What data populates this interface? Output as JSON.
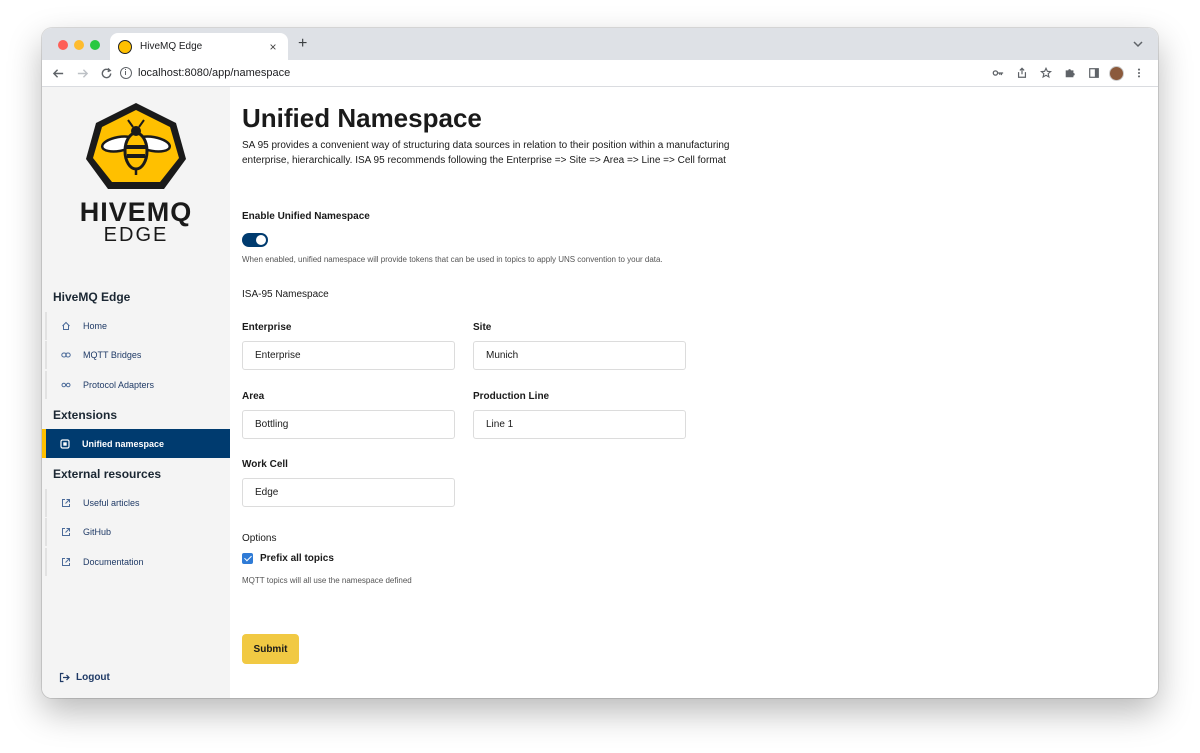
{
  "browser": {
    "tab_title": "HiveMQ Edge",
    "new_tab": "+",
    "tab_close": "×",
    "url": "localhost:8080/app/namespace"
  },
  "sidebar": {
    "logo_word": "HIVEMQ",
    "logo_sub": "EDGE",
    "sections": [
      {
        "title": "HiveMQ Edge",
        "items": [
          {
            "label": "Home",
            "icon": "home-icon"
          },
          {
            "label": "MQTT Bridges",
            "icon": "link-icon"
          },
          {
            "label": "Protocol Adapters",
            "icon": "adapter-icon"
          }
        ]
      },
      {
        "title": "Extensions",
        "items": [
          {
            "label": "Unified namespace",
            "icon": "namespace-icon",
            "active": true
          }
        ]
      },
      {
        "title": "External resources",
        "items": [
          {
            "label": "Useful articles",
            "icon": "external-link-icon"
          },
          {
            "label": "GitHub",
            "icon": "external-link-icon"
          },
          {
            "label": "Documentation",
            "icon": "external-link-icon"
          }
        ]
      }
    ],
    "logout": "Logout"
  },
  "main": {
    "title": "Unified Namespace",
    "description": "SA 95 provides a convenient way of structuring data sources in relation to their position within a manufacturing enterprise, hierarchically. ISA 95 recommends following the Enterprise => Site => Area => Line => Cell format",
    "enable_label": "Enable Unified Namespace",
    "enable_value": true,
    "enable_helper": "When enabled, unified namespace will provide tokens that can be used in topics to apply UNS convention to your data.",
    "namespace_heading": "ISA-95 Namespace",
    "fields": {
      "enterprise": {
        "label": "Enterprise",
        "value": "Enterprise"
      },
      "site": {
        "label": "Site",
        "value": "Munich"
      },
      "area": {
        "label": "Area",
        "value": "Bottling"
      },
      "production_line": {
        "label": "Production Line",
        "value": "Line 1"
      },
      "work_cell": {
        "label": "Work Cell",
        "value": "Edge"
      }
    },
    "options_heading": "Options",
    "prefix_label": "Prefix all topics",
    "prefix_checked": true,
    "prefix_helper": "MQTT topics will all use the namespace defined",
    "submit_label": "Submit"
  },
  "colors": {
    "brand_yellow": "#ffc000",
    "active_nav": "#003b6f",
    "submit": "#f1c943",
    "checkbox": "#2f7bd6"
  }
}
